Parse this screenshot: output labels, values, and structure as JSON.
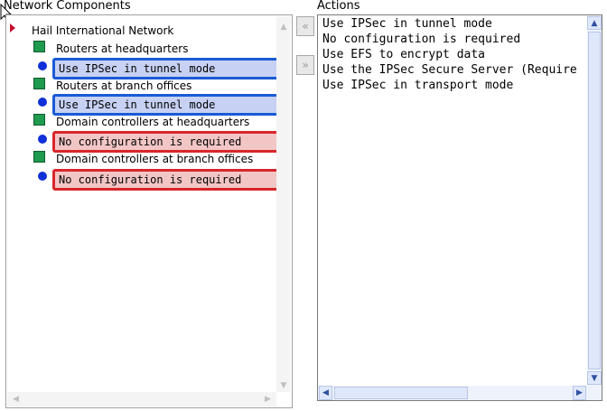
{
  "labels": {
    "left": "Network Components",
    "right": "Actions"
  },
  "tree": {
    "root": "Hail International Network",
    "nodes": [
      {
        "label": "Routers at headquarters",
        "slot": "Use IPSec in tunnel mode"
      },
      {
        "label": "Routers at branch offices",
        "slot": "Use IPSec in tunnel mode"
      },
      {
        "label": "Domain controllers at headquarters",
        "slot": "No configuration is required"
      },
      {
        "label": "Domain controllers at branch offices",
        "slot": "No configuration is required"
      }
    ]
  },
  "actions": [
    "Use IPSec in tunnel mode",
    "No configuration is required",
    "Use EFS to encrypt data",
    "Use the IPSec Secure Server (Require Security)",
    "Use IPSec in transport mode"
  ],
  "buttons": {
    "move_left": "«",
    "move_right": "»"
  },
  "colors": {
    "slot_blue_border": "#1a5bd6",
    "slot_red_border": "#d8262b",
    "node_square": "#1f9a4e",
    "bullet": "#1030d8"
  }
}
